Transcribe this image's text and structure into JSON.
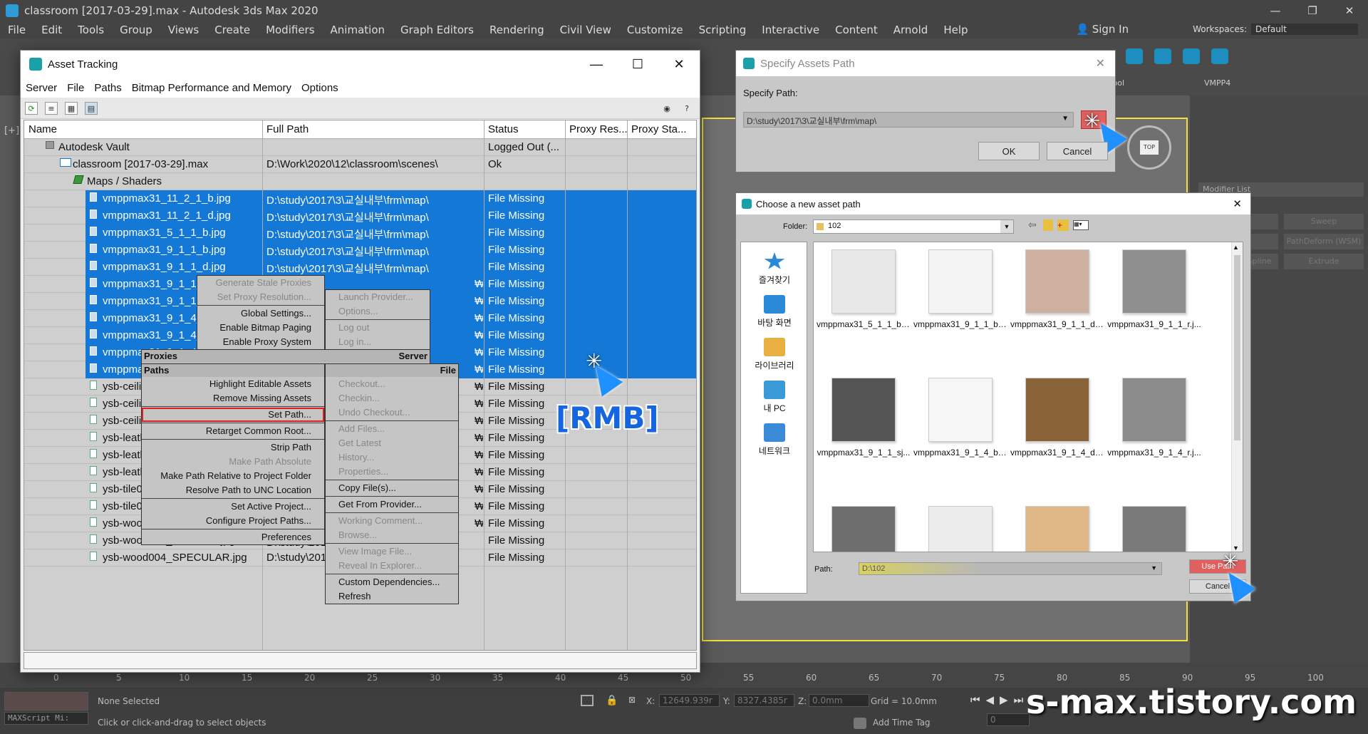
{
  "app": {
    "title": "classroom [2017-03-29].max - Autodesk 3ds Max 2020",
    "menus": [
      "File",
      "Edit",
      "Tools",
      "Group",
      "Views",
      "Create",
      "Modifiers",
      "Animation",
      "Graph Editors",
      "Rendering",
      "Civil View",
      "Customize",
      "Scripting",
      "Interactive",
      "Content",
      "Arnold",
      "Help"
    ],
    "sign_in": "Sign In",
    "workspaces_label": "Workspaces:",
    "workspaces_value": "Default",
    "viewport_label": "[+]",
    "toolbar_labels": [
      "IDTool",
      "VMPP4"
    ],
    "modifier_list": "Modifier List",
    "modifier_buttons": [
      "Lathe",
      "Sweep",
      "Lattice",
      "PathDeform (WSM)",
      "Normalize Spline",
      "Extrude"
    ],
    "timeline_ticks": [
      "0",
      "5",
      "10",
      "15",
      "20",
      "25",
      "30",
      "35",
      "40",
      "45",
      "50",
      "55",
      "60",
      "65",
      "70",
      "75",
      "80",
      "85",
      "90",
      "95",
      "100"
    ],
    "status": {
      "none_selected": "None Selected",
      "hint": "Click or click-and-drag to select objects",
      "maxscript": "MAXScript Mi:",
      "x_label": "X:",
      "x_value": "12649.939r",
      "y_label": "Y:",
      "y_value": "8327.4385r",
      "z_label": "Z:",
      "z_value": "0.0mm",
      "grid": "Grid = 10.0mm",
      "add_time_tag": "Add Time Tag",
      "frame": "0"
    },
    "watermark": "s-max.tistory.com"
  },
  "asset_tracking": {
    "title": "Asset Tracking",
    "menus": [
      "Server",
      "File",
      "Paths",
      "Bitmap Performance and Memory",
      "Options"
    ],
    "columns": [
      "Name",
      "Full Path",
      "Status",
      "Proxy Res...",
      "Proxy Sta..."
    ],
    "rows": [
      {
        "name": "Autodesk Vault",
        "path": "",
        "status": "Logged Out (...",
        "indent": 1,
        "sel": false,
        "icon": "vault"
      },
      {
        "name": "classroom [2017-03-29].max",
        "path": "D:\\Work\\2020\\12\\classroom\\scenes\\",
        "status": "Ok",
        "indent": 2,
        "sel": false,
        "icon": "max"
      },
      {
        "name": "Maps / Shaders",
        "path": "",
        "status": "",
        "indent": 3,
        "sel": false,
        "icon": "maps"
      },
      {
        "name": "vmppmax31_11_2_1_b.jpg",
        "path": "D:\\study\\2017\\3\\교실내부\\frm\\map\\",
        "status": "File Missing",
        "indent": 4,
        "sel": true,
        "icon": "file"
      },
      {
        "name": "vmppmax31_11_2_1_d.jpg",
        "path": "D:\\study\\2017\\3\\교실내부\\frm\\map\\",
        "status": "File Missing",
        "indent": 4,
        "sel": true,
        "icon": "file"
      },
      {
        "name": "vmppmax31_5_1_1_b.jpg",
        "path": "D:\\study\\2017\\3\\교실내부\\frm\\map\\",
        "status": "File Missing",
        "indent": 4,
        "sel": true,
        "icon": "file"
      },
      {
        "name": "vmppmax31_9_1_1_b.jpg",
        "path": "D:\\study\\2017\\3\\교실내부\\frm\\map\\",
        "status": "File Missing",
        "indent": 4,
        "sel": true,
        "icon": "file"
      },
      {
        "name": "vmppmax31_9_1_1_d.jpg",
        "path": "D:\\study\\2017\\3\\교실내부\\frm\\map\\",
        "status": "File Missing",
        "indent": 4,
        "sel": true,
        "icon": "file"
      },
      {
        "name": "vmppmax31_9_1_1_r",
        "path": "",
        "status": "File Missing",
        "indent": 4,
        "sel": true,
        "icon": "file"
      },
      {
        "name": "vmppmax31_9_1_1_s",
        "path": "",
        "status": "File Missing",
        "indent": 4,
        "sel": true,
        "icon": "file"
      },
      {
        "name": "vmppmax31_9_1_4_b",
        "path": "",
        "status": "File Missing",
        "indent": 4,
        "sel": true,
        "icon": "file"
      },
      {
        "name": "vmppmax31_9_1_4_d",
        "path": "",
        "status": "File Missing",
        "indent": 4,
        "sel": true,
        "icon": "file"
      },
      {
        "name": "vmppmax31_9_1_4_r",
        "path": "",
        "status": "File Missing",
        "indent": 4,
        "sel": true,
        "icon": "file"
      },
      {
        "name": "vmppma",
        "path": "",
        "status": "File Missing",
        "indent": 4,
        "sel": true,
        "icon": "file"
      },
      {
        "name": "ysb-ceili",
        "path": "",
        "status": "File Missing",
        "indent": 4,
        "sel": false,
        "icon": "file"
      },
      {
        "name": "ysb-ceili",
        "path": "",
        "status": "File Missing",
        "indent": 4,
        "sel": false,
        "icon": "file"
      },
      {
        "name": "ysb-ceili",
        "path": "",
        "status": "File Missing",
        "indent": 4,
        "sel": false,
        "icon": "file"
      },
      {
        "name": "ysb-leath",
        "path": "",
        "status": "File Missing",
        "indent": 4,
        "sel": false,
        "icon": "file"
      },
      {
        "name": "ysb-leath",
        "path": "",
        "status": "File Missing",
        "indent": 4,
        "sel": false,
        "icon": "file"
      },
      {
        "name": "ysb-leath",
        "path": "",
        "status": "File Missing",
        "indent": 4,
        "sel": false,
        "icon": "file"
      },
      {
        "name": "ysb-tile0",
        "path": "",
        "status": "File Missing",
        "indent": 4,
        "sel": false,
        "icon": "file"
      },
      {
        "name": "ysb-tile0",
        "path": "",
        "status": "File Missing",
        "indent": 4,
        "sel": false,
        "icon": "file"
      },
      {
        "name": "ysb-woo",
        "path": "",
        "status": "File Missing",
        "indent": 4,
        "sel": false,
        "icon": "file"
      },
      {
        "name": "ysb-wood004_NORMAL.jpg",
        "path": "D:\\study\\2017\\3\\교실내부\\frm\\map\\",
        "status": "File Missing",
        "indent": 4,
        "sel": false,
        "icon": "file"
      },
      {
        "name": "ysb-wood004_SPECULAR.jpg",
        "path": "D:\\study\\2017",
        "status": "File Missing",
        "indent": 4,
        "sel": false,
        "icon": "file"
      }
    ],
    "path_tail": "₩"
  },
  "context_menu": {
    "proxies": {
      "items": [
        {
          "label": "Generate Stale Proxies",
          "dis": true
        },
        {
          "label": "Set Proxy Resolution...",
          "dis": true
        },
        {
          "label": "Global Settings...",
          "dis": false
        },
        {
          "label": "Enable Bitmap Paging",
          "dis": false
        },
        {
          "label": "Enable Proxy System",
          "dis": false
        }
      ],
      "header_left": "Proxies",
      "header_right": "Server"
    },
    "server": {
      "items": [
        {
          "label": "Launch Provider...",
          "dis": true
        },
        {
          "label": "Options...",
          "dis": true
        },
        {
          "label": "Log out",
          "dis": true
        },
        {
          "label": "Log in...",
          "dis": true
        }
      ]
    },
    "paths": {
      "header_left": "Paths",
      "header_right": "File",
      "items": [
        {
          "label": "Highlight Editable Assets",
          "dis": false
        },
        {
          "label": "Remove Missing Assets",
          "dis": false
        },
        {
          "label": "Set Path...",
          "dis": false,
          "hl": true
        },
        {
          "label": "Retarget Common Root...",
          "dis": false
        },
        {
          "label": "Strip Path",
          "dis": false
        },
        {
          "label": "Make Path Absolute",
          "dis": true
        },
        {
          "label": "Make Path Relative to Project Folder",
          "dis": false
        },
        {
          "label": "Resolve Path to UNC Location",
          "dis": false
        },
        {
          "label": "Set Active Project...",
          "dis": false
        },
        {
          "label": "Configure Project Paths...",
          "dis": false
        },
        {
          "label": "Preferences",
          "dis": false
        }
      ]
    },
    "file": {
      "items": [
        {
          "label": "Checkout...",
          "dis": true
        },
        {
          "label": "Checkin...",
          "dis": true
        },
        {
          "label": "Undo Checkout...",
          "dis": true
        },
        {
          "label": "Add Files...",
          "dis": true
        },
        {
          "label": "Get Latest",
          "dis": true
        },
        {
          "label": "History...",
          "dis": true
        },
        {
          "label": "Properties...",
          "dis": true
        },
        {
          "label": "Copy File(s)...",
          "dis": false
        },
        {
          "label": "Get From Provider...",
          "dis": false
        },
        {
          "label": "Working Comment...",
          "dis": true
        },
        {
          "label": "Browse...",
          "dis": true
        },
        {
          "label": "View Image File...",
          "dis": true
        },
        {
          "label": "Reveal In Explorer...",
          "dis": true
        },
        {
          "label": "Custom Dependencies...",
          "dis": false
        },
        {
          "label": "Refresh",
          "dis": false
        }
      ]
    },
    "annotation": "[RMB]"
  },
  "specify_dialog": {
    "title": "Specify Assets Path",
    "label": "Specify Path:",
    "value": "D:\\study\\2017\\3\\교실내부\\frm\\map\\",
    "ok": "OK",
    "cancel": "Cancel"
  },
  "choose_dialog": {
    "title": "Choose a new asset path",
    "folder_label": "Folder:",
    "folder_value": "102",
    "places": [
      "즐겨찾기",
      "바탕 화면",
      "라이브러리",
      "내 PC",
      "네트워크"
    ],
    "thumbs": [
      {
        "name": "vmppmax31_5_1_1_b.jpg",
        "color": "#e8e8e8"
      },
      {
        "name": "vmppmax31_9_1_1_b.j...",
        "color": "#f4f4f4"
      },
      {
        "name": "vmppmax31_9_1_1_d.j...",
        "color": "#cdb0a0"
      },
      {
        "name": "vmppmax31_9_1_1_r.j...",
        "color": "#8f8f8f"
      },
      {
        "name": "vmppmax31_9_1_1_sj...",
        "color": "#555555"
      },
      {
        "name": "vmppmax31_9_1_4_b.j...",
        "color": "#f6f6f6"
      },
      {
        "name": "vmppmax31_9_1_4_d.j...",
        "color": "#8a6238"
      },
      {
        "name": "vmppmax31_9_1_4_r.j...",
        "color": "#8c8c8c"
      },
      {
        "name": "",
        "color": "#6e6e6e"
      },
      {
        "name": "",
        "color": "#ececec"
      },
      {
        "name": "",
        "color": "#e0b888"
      },
      {
        "name": "",
        "color": "#7a7a7a"
      }
    ],
    "path_label": "Path:",
    "path_value": "D:\\102",
    "use_path": "Use Path",
    "cancel": "Cancel"
  }
}
